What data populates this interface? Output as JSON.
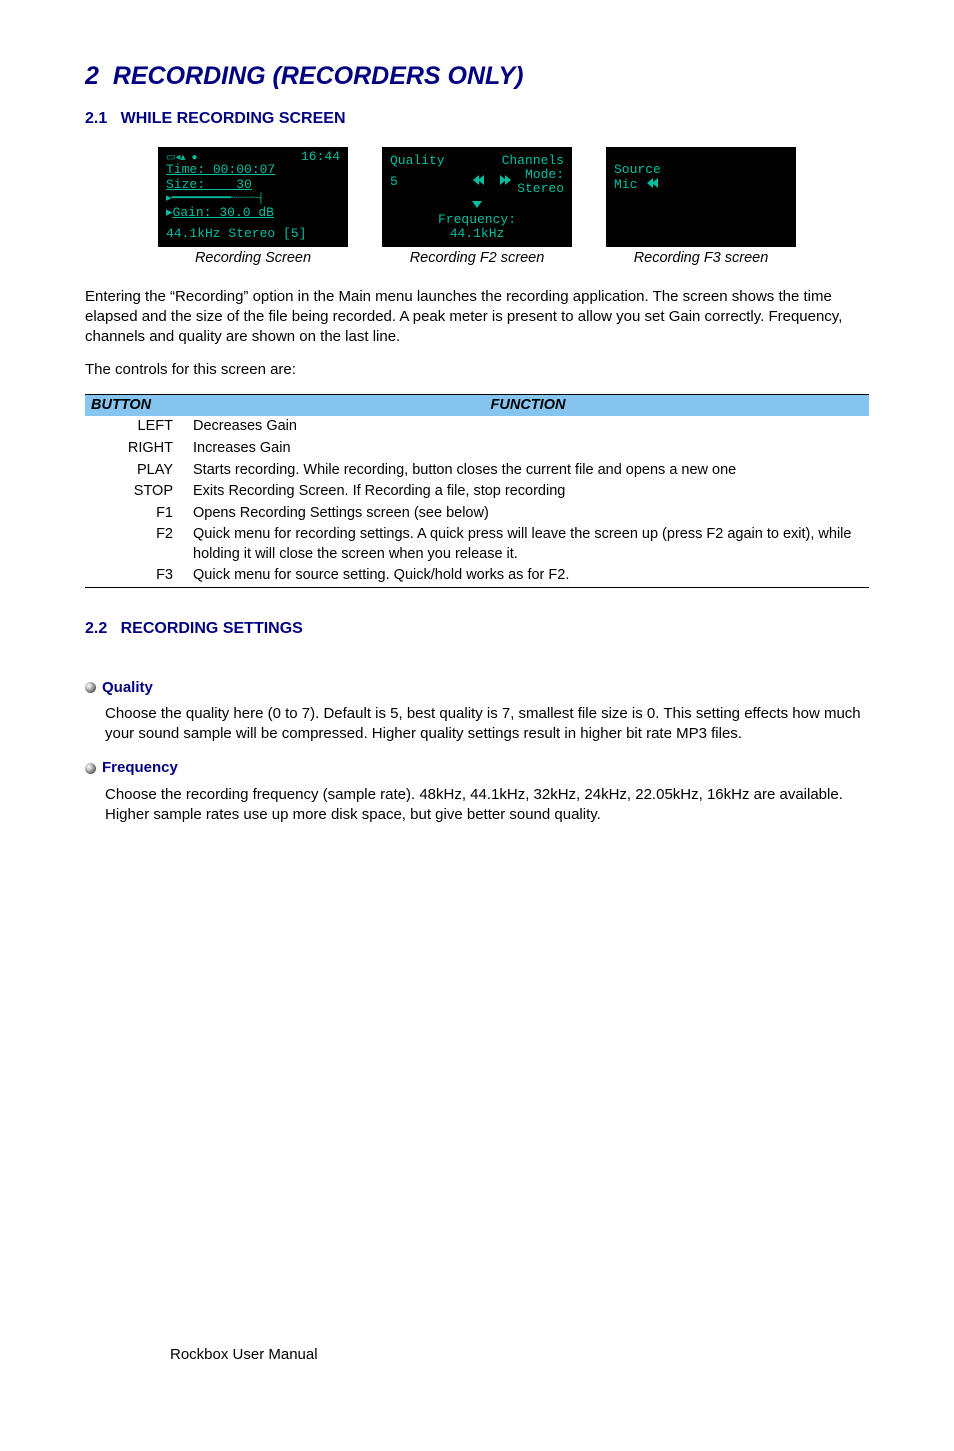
{
  "section": {
    "number": "2",
    "title": "RECORDING (RECORDERS ONLY)"
  },
  "sub1": {
    "number": "2.1",
    "title": "WHILE RECORDING SCREEN"
  },
  "sub2": {
    "number": "2.2",
    "title": "RECORDING SETTINGS"
  },
  "figs": {
    "rec": {
      "clock": "16:44",
      "time_label": "Time:",
      "time_val": "00:00:07",
      "size_label": "Size:",
      "size_val": "30",
      "gain_line": "Gain: 30.0 dB",
      "bottom": "44.1kHz Stereo [5]",
      "caption": "Recording Screen"
    },
    "f2": {
      "quality_label": "Quality",
      "quality_val": "5",
      "channels_label": "Channels",
      "mode_label": "Mode:",
      "mode_val": "Stereo",
      "freq_label": "Frequency:",
      "freq_val": "44.1kHz",
      "caption": "Recording F2 screen"
    },
    "f3": {
      "source_label": "Source",
      "source_val": "Mic",
      "caption": "Recording F3 screen"
    }
  },
  "para1": "Entering the “Recording” option in the Main menu launches the recording application. The screen shows the time elapsed and the size of the file being recorded. A peak meter is present to allow you set Gain correctly. Frequency, channels and quality are shown on the last line.",
  "para2": "The controls for this screen are:",
  "table": {
    "head_button": "BUTTON",
    "head_function": "FUNCTION",
    "rows": [
      {
        "b": "LEFT",
        "f": "Decreases Gain"
      },
      {
        "b": "RIGHT",
        "f": "Increases Gain"
      },
      {
        "b": "PLAY",
        "f": "Starts recording.  While recording, button closes the current file and opens a new one"
      },
      {
        "b": "STOP",
        "f": "Exits Recording Screen. If Recording a file, stop recording"
      },
      {
        "b": "F1",
        "f": "Opens Recording Settings screen (see below)"
      },
      {
        "b": "F2",
        "f": "Quick menu for recording settings. A quick press will leave the screen up (press F2 again to exit), while holding it will close the screen when you release it."
      },
      {
        "b": "F3",
        "f": "Quick menu for source setting. Quick/hold works as for F2."
      }
    ]
  },
  "settings": {
    "quality": {
      "title": "Quality",
      "body": "Choose the quality here (0 to 7). Default is 5, best quality is 7, smallest file size is 0.  This setting effects how much your sound sample will be compressed.  Higher quality settings result in higher bit rate MP3 files."
    },
    "frequency": {
      "title": "Frequency",
      "body": "Choose the recording frequency (sample rate). 48kHz, 44.1kHz, 32kHz, 24kHz, 22.05kHz, 16kHz are available.  Higher sample rates use up more disk space, but give better sound quality."
    }
  },
  "footer": "Rockbox User Manual"
}
